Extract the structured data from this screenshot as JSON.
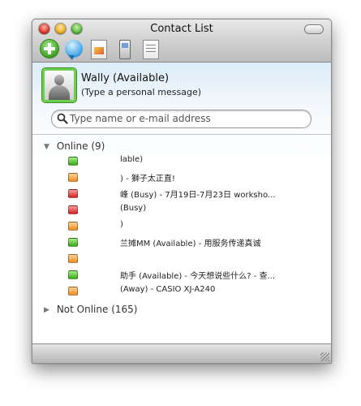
{
  "window": {
    "title": "Contact List"
  },
  "toolbar": {
    "buttons": [
      {
        "name": "add-contact",
        "icon": "plus-circle-icon"
      },
      {
        "name": "start-chat",
        "icon": "chat-bubble-icon"
      },
      {
        "name": "send-file",
        "icon": "picture-file-icon"
      },
      {
        "name": "phone",
        "icon": "phone-icon"
      },
      {
        "name": "notes",
        "icon": "notepad-icon"
      }
    ]
  },
  "user": {
    "name": "Wally (Available)",
    "message": "(Type a personal message)"
  },
  "search": {
    "placeholder": "Type name or e-mail address"
  },
  "groups": {
    "online": {
      "label": "Online (9)"
    },
    "offline": {
      "label": "Not Online (165)"
    }
  },
  "contacts": [
    {
      "status": "available",
      "text": "lable)"
    },
    {
      "status": "away",
      "text": ") - 獅子太正直!"
    },
    {
      "status": "busy",
      "text": "峰 (Busy) - 7月19日-7月23日 worksho..."
    },
    {
      "status": "busy",
      "text": "(Busy)"
    },
    {
      "status": "away",
      "text": ")"
    },
    {
      "status": "available",
      "text": "兰摊MM (Available) - 用服务传递真诚"
    },
    {
      "status": "away",
      "text": ""
    },
    {
      "status": "available",
      "text": "助手 (Available) - 今天想说些什么? - 查..."
    },
    {
      "status": "away",
      "text": "(Away) - CASIO XJ-A240"
    }
  ],
  "colors": {
    "available": "#3aa021",
    "away": "#f08b1c",
    "busy": "#d42121",
    "avatar_border": "#6ccf4f"
  }
}
